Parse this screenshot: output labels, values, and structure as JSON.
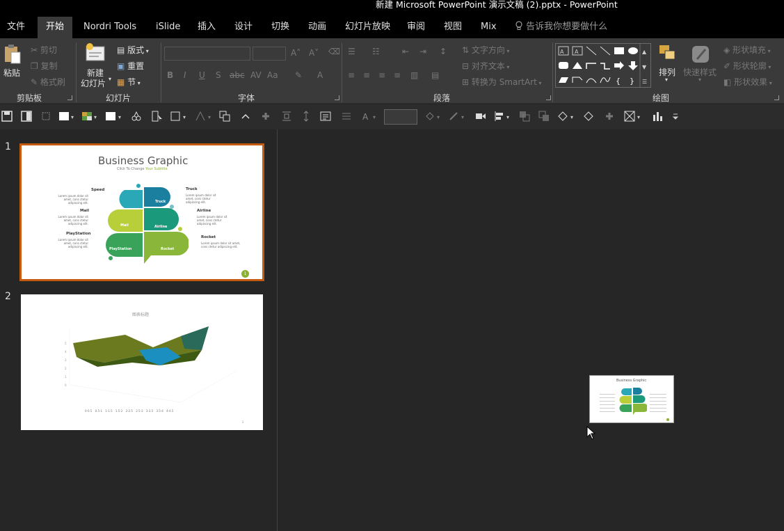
{
  "window": {
    "title": "新建 Microsoft PowerPoint 演示文稿 (2).pptx  -  PowerPoint"
  },
  "tabs": [
    {
      "label": "文件"
    },
    {
      "label": "开始"
    },
    {
      "label": "Nordri Tools"
    },
    {
      "label": "iSlide"
    },
    {
      "label": "插入"
    },
    {
      "label": "设计"
    },
    {
      "label": "切换"
    },
    {
      "label": "动画"
    },
    {
      "label": "幻灯片放映"
    },
    {
      "label": "审阅"
    },
    {
      "label": "视图"
    },
    {
      "label": "Mix"
    }
  ],
  "tell_me": "告诉我你想要做什么",
  "ribbon": {
    "clipboard": {
      "paste": "粘贴",
      "cut": "剪切",
      "copy": "复制",
      "format_painter": "格式刷",
      "label": "剪贴板"
    },
    "slides": {
      "new_slide_1": "新建",
      "new_slide_2": "幻灯片",
      "layout": "版式",
      "reset": "重置",
      "section": "节",
      "label": "幻灯片"
    },
    "font": {
      "label": "字体"
    },
    "paragraph": {
      "text_direction": "文字方向",
      "align_text": "对齐文本",
      "smartart": "转换为 SmartArt",
      "label": "段落"
    },
    "drawing": {
      "arrange": "排列",
      "quick_styles": "快速样式",
      "shape_fill": "形状填充",
      "shape_outline": "形状轮廓",
      "shape_effects": "形状效果",
      "label": "绘图"
    }
  },
  "slides": [
    {
      "number": "1",
      "title": "Business Graphic",
      "subtitle_a": "Click To Change ",
      "subtitle_b": "Your Subtitle",
      "items": {
        "speed": "Speed",
        "truck": "Truck",
        "mail": "Mail",
        "airline": "Airline",
        "playstation": "PlayStation",
        "rocket": "Rocket"
      },
      "lorem": "Lorem ipsum dolor sit amet, cons ctetur adipiscing elit.",
      "page": "1"
    },
    {
      "number": "2",
      "chart_title": "图表标题",
      "page": "2",
      "legend": [
        "0-0.5",
        "0.5-1",
        "1-1.5",
        "1.5-2",
        "2-2.5",
        "2.5-3",
        "3-3.5",
        "3.5-4",
        "4-4.5",
        "4.5-5"
      ]
    }
  ],
  "colors": {
    "accent": "#c55a11",
    "teal": "#1a8a9e",
    "green": "#7ab648",
    "olive": "#8a9a2a",
    "blue": "#1b7fc0"
  }
}
